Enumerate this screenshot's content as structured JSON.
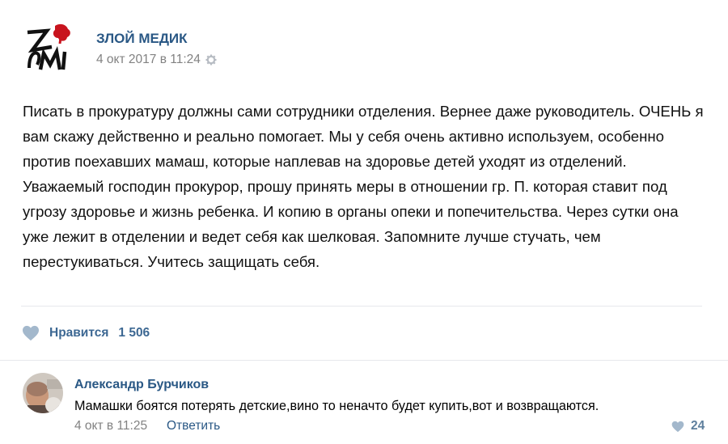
{
  "post": {
    "author": "ЗЛОЙ МЕДИК",
    "date": "4 окт 2017 в 11:24",
    "text": "Писать в прокуратуру должны сами сотрудники отделения. Вернее даже руководитель. ОЧЕНЬ я вам скажу действенно и реально помогает. Мы у себя очень активно используем, особенно против поехавших мамаш, которые наплевав на здоровье детей уходят из отделений. Уважаемый господин прокурор, прошу принять меры в отношении гр. П. которая ставит под угрозу здоровье и жизнь ребенка. И копию в органы опеки и попечительства. Через сутки она уже лежит в отделении и ведет себя как шелковая. Запомните лучше стучать, чем перестукиваться. Учитесь защищать себя.",
    "like_label": "Нравится",
    "like_count": "1 506"
  },
  "comment": {
    "author": "Александр Бурчиков",
    "text": "Мамашки боятся потерять детские,вино то ненач‍то будет купить,вот и возвращаются.",
    "date": "4 окт в 11:25",
    "reply_label": "Ответить",
    "like_count": "24"
  },
  "colors": {
    "link": "#2a5885",
    "meta": "#828282",
    "heart": "#a3b8cc",
    "logo_red": "#c8141e"
  }
}
